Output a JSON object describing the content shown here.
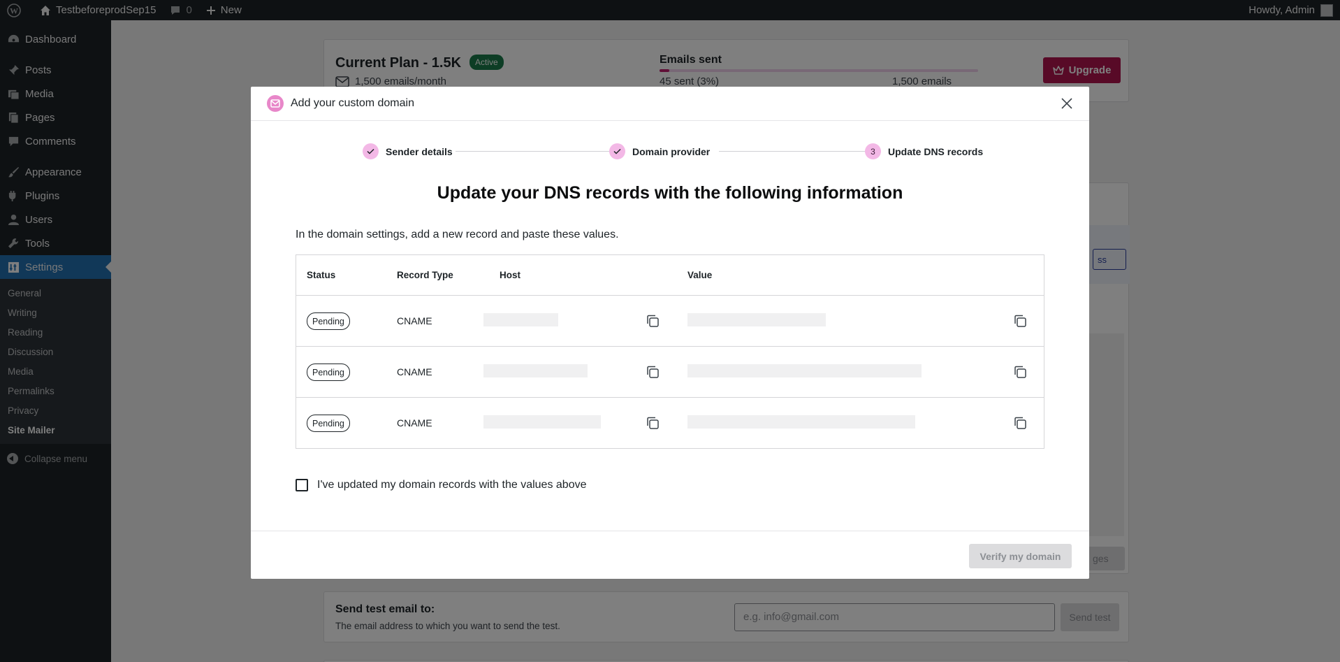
{
  "admin_bar": {
    "site_name": "TestbeforeprodSep15",
    "comments_count": "0",
    "new_label": "New",
    "howdy": "Howdy, Admin"
  },
  "sidebar": {
    "items": [
      {
        "label": "Dashboard",
        "icon": "dashboard-icon"
      },
      {
        "label": "Posts",
        "icon": "pin-icon"
      },
      {
        "label": "Media",
        "icon": "media-icon"
      },
      {
        "label": "Pages",
        "icon": "pages-icon"
      },
      {
        "label": "Comments",
        "icon": "comment-icon"
      },
      {
        "label": "Appearance",
        "icon": "brush-icon"
      },
      {
        "label": "Plugins",
        "icon": "plugin-icon"
      },
      {
        "label": "Users",
        "icon": "user-icon"
      },
      {
        "label": "Tools",
        "icon": "wrench-icon"
      },
      {
        "label": "Settings",
        "icon": "settings-icon"
      }
    ],
    "submenu": [
      "General",
      "Writing",
      "Reading",
      "Discussion",
      "Media",
      "Permalinks",
      "Privacy",
      "Site Mailer"
    ],
    "collapse_label": "Collapse menu"
  },
  "background": {
    "plan_title": "Current Plan - 1.5K",
    "plan_badge": "Active",
    "plan_sub": "1,500 emails/month",
    "emails_sent_label": "Emails sent",
    "emails_sent_fraction": 0.03,
    "emails_sent_count": "45 sent (3%)",
    "emails_total": "1,500 emails",
    "upgrade_label": "Upgrade",
    "blue_button_partial": "ss",
    "save_button_partial": "ges",
    "test_title": "Send test email to:",
    "test_desc": "The email address to which you want to send the test.",
    "test_placeholder": "e.g. info@gmail.com",
    "test_button": "Send test"
  },
  "modal": {
    "title": "Add your custom domain",
    "steps": [
      {
        "label": "Sender details",
        "state": "done"
      },
      {
        "label": "Domain provider",
        "state": "done"
      },
      {
        "label": "Update DNS records",
        "state": "current",
        "number": "3"
      }
    ],
    "heading": "Update your DNS records with the following information",
    "intro": "In the domain settings, add a new record and paste these values.",
    "table": {
      "headers": [
        "Status",
        "Record Type",
        "Host",
        "Value"
      ],
      "rows": [
        {
          "status": "Pending",
          "type": "CNAME"
        },
        {
          "status": "Pending",
          "type": "CNAME"
        },
        {
          "status": "Pending",
          "type": "CNAME"
        }
      ]
    },
    "confirm_label": "I've updated my domain records with the values above",
    "verify_label": "Verify my domain"
  },
  "colors": {
    "accent": "#b0154e",
    "step_circle": "#f3b8e6",
    "active_badge": "#1b7b4a",
    "wp_admin_blue": "#2271b1"
  }
}
